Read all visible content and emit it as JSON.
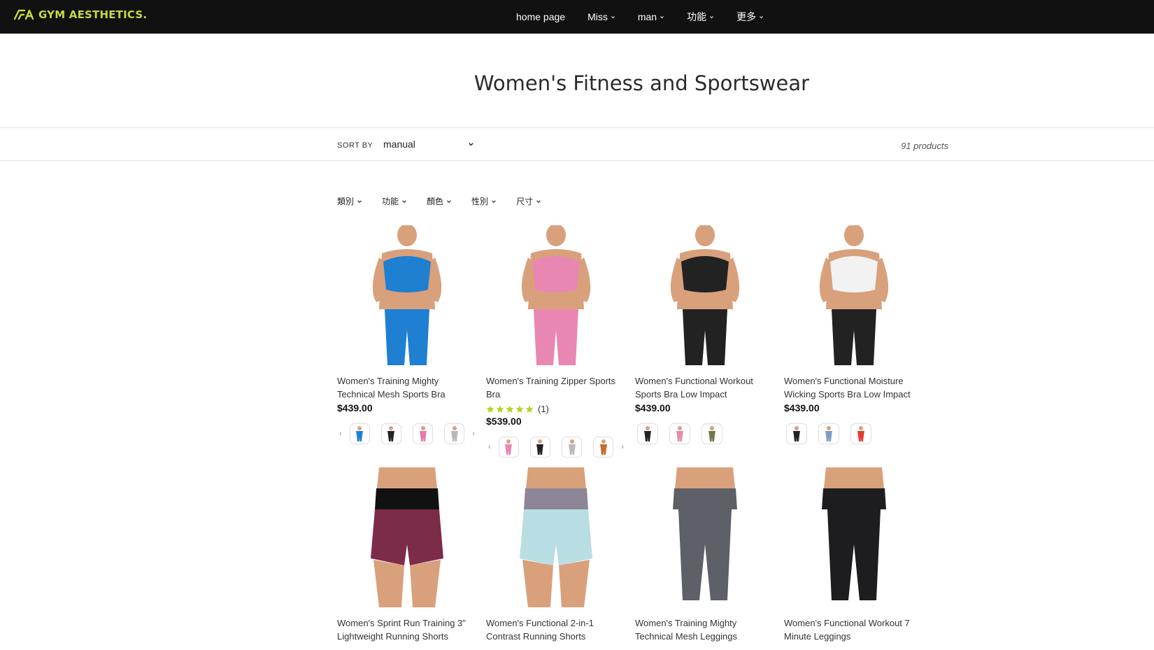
{
  "header": {
    "logo_text": "GYM AESTHETICS.",
    "nav": [
      {
        "label": "home page",
        "has_dropdown": false
      },
      {
        "label": "Miss",
        "has_dropdown": true
      },
      {
        "label": "man",
        "has_dropdown": true
      },
      {
        "label": "功能",
        "has_dropdown": true
      },
      {
        "label": "更多",
        "has_dropdown": true
      }
    ]
  },
  "collection": {
    "title": "Women's Fitness and Sportswear",
    "sort_label": "SORT BY",
    "sort_value": "manual",
    "product_count": "91 products"
  },
  "filters": [
    {
      "label": "類別"
    },
    {
      "label": "功能"
    },
    {
      "label": "顏色"
    },
    {
      "label": "性別"
    },
    {
      "label": "尺寸"
    }
  ],
  "products": [
    {
      "name": "Women's Training Mighty Technical Mesh Sports Bra",
      "price": "$439.00",
      "rating_count": "",
      "top_color": "#1f7fd0",
      "bottom_color": "#1f7fd0",
      "swatches": [
        "#1f7fd0",
        "#222222",
        "#e57aa8",
        "#b9b9b9"
      ],
      "has_arrows": true
    },
    {
      "name": "Women's Training Zipper Sports Bra",
      "price": "$539.00",
      "rating_count": "(1)",
      "stars": 5,
      "top_color": "#e987b2",
      "bottom_color": "#e987b2",
      "swatches": [
        "#e987b2",
        "#222222",
        "#b9b9b9",
        "#c76a2a"
      ],
      "has_arrows": true
    },
    {
      "name": "Women's Functional Workout Sports Bra Low Impact",
      "price": "$439.00",
      "rating_count": "",
      "top_color": "#222222",
      "bottom_color": "#222222",
      "swatches": [
        "#222222",
        "#e48da8",
        "#6f7a46"
      ],
      "has_arrows": false
    },
    {
      "name": "Women's Functional Moisture Wicking Sports Bra Low Impact",
      "price": "$439.00",
      "rating_count": "",
      "top_color": "#f2f2f2",
      "bottom_color": "#222222",
      "swatches": [
        "#222222",
        "#7d9dc4",
        "#e23b2a"
      ],
      "has_arrows": false
    },
    {
      "name": "Women's Sprint Run Training 3\" Lightweight Running Shorts",
      "price": "",
      "rating_count": "",
      "top_color": "#111111",
      "bottom_color": "#7b2c48",
      "swatches": [],
      "has_arrows": false
    },
    {
      "name": "Women's Functional 2-in-1 Contrast Running Shorts",
      "price": "",
      "rating_count": "",
      "top_color": "#8c8696",
      "bottom_color": "#b8dde3",
      "swatches": [],
      "has_arrows": false
    },
    {
      "name": "Women's Training Mighty Technical Mesh Leggings",
      "price": "",
      "rating_count": "",
      "top_color": "#5d6066",
      "bottom_color": "#5d6066",
      "swatches": [],
      "has_arrows": false
    },
    {
      "name": "Women's Functional Workout 7 Minute Leggings",
      "price": "",
      "rating_count": "",
      "top_color": "#1d1d1f",
      "bottom_color": "#1d1d1f",
      "swatches": [],
      "has_arrows": false
    }
  ],
  "colors": {
    "header_bg": "#111111",
    "logo_accent": "#c8d93f",
    "star": "#b5d21e",
    "skin": "#d9a07c"
  }
}
